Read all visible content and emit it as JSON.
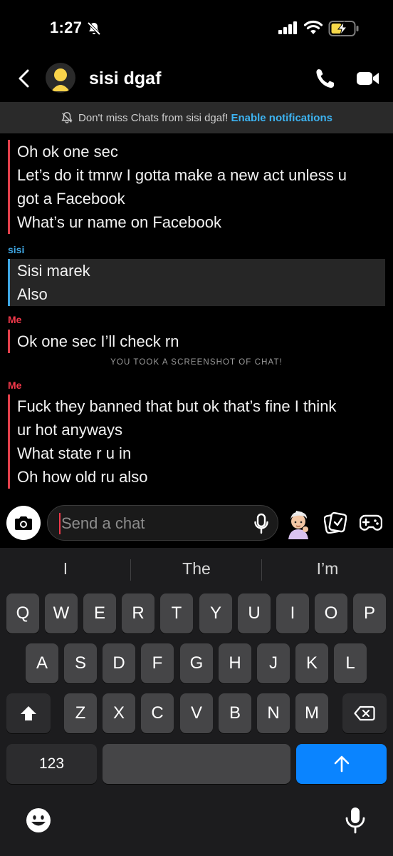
{
  "status_bar": {
    "time": "1:27"
  },
  "header": {
    "title": "sisi dgaf"
  },
  "notification": {
    "text": "Don't miss Chats from sisi dgaf!",
    "link": "Enable notifications"
  },
  "messages": {
    "group1": {
      "lines": [
        "Oh ok one sec",
        "Let’s do it tmrw I gotta make a new act unless u",
        "got a Facebook",
        "What’s ur name on Facebook"
      ]
    },
    "group2": {
      "sender": "sisi",
      "lines": [
        "Sisi marek",
        "Also"
      ]
    },
    "group3": {
      "sender": "Me",
      "lines": [
        "Ok one sec I’ll check rn"
      ]
    },
    "screenshot_notice": "YOU TOOK A SCREENSHOT OF CHAT!",
    "group4": {
      "sender": "Me",
      "lines": [
        "Fuck they banned that but ok that’s fine I think",
        "ur hot anyways",
        "What state r u in",
        "Oh how old ru also"
      ]
    }
  },
  "composer": {
    "placeholder": "Send a chat"
  },
  "keyboard": {
    "suggestions": [
      "I",
      "The",
      "I’m"
    ],
    "row1": [
      "Q",
      "W",
      "E",
      "R",
      "T",
      "Y",
      "U",
      "I",
      "O",
      "P"
    ],
    "row2": [
      "A",
      "S",
      "D",
      "F",
      "G",
      "H",
      "J",
      "K",
      "L"
    ],
    "row3": [
      "Z",
      "X",
      "C",
      "V",
      "B",
      "N",
      "M"
    ],
    "numbers_key": "123"
  },
  "colors": {
    "me": "#f0384a",
    "them": "#3fa7e4",
    "link": "#3db3f1",
    "send": "#0a84ff"
  }
}
